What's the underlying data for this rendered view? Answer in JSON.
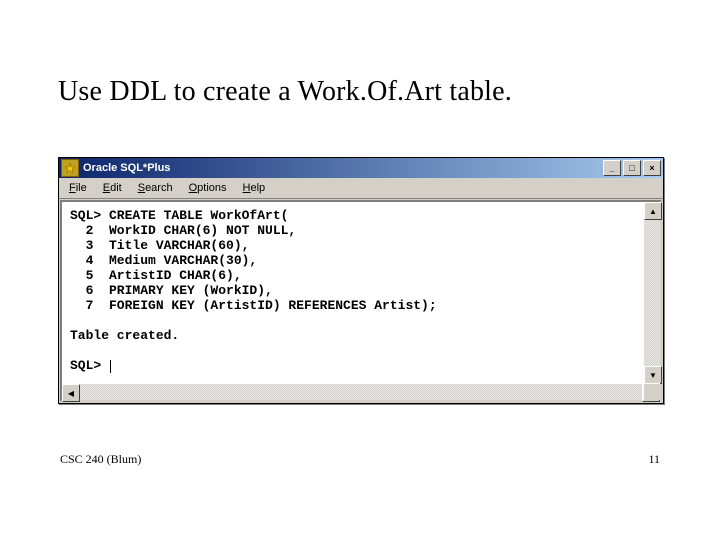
{
  "slide": {
    "title": "Use DDL to create a Work.Of.Art table.",
    "footer_left": "CSC 240 (Blum)",
    "footer_right": "11"
  },
  "window": {
    "title": "Oracle SQL*Plus",
    "menu": {
      "file": "File",
      "edit": "Edit",
      "search": "Search",
      "options": "Options",
      "help": "Help"
    },
    "buttons": {
      "minimize": "_",
      "maximize": "□",
      "close": "×"
    }
  },
  "terminal": {
    "prompt": "SQL>",
    "lines": [
      "SQL> CREATE TABLE WorkOfArt(",
      "  2  WorkID CHAR(6) NOT NULL,",
      "  3  Title VARCHAR(60),",
      "  4  Medium VARCHAR(30),",
      "  5  ArtistID CHAR(6),",
      "  6  PRIMARY KEY (WorkID),",
      "  7  FOREIGN KEY (ArtistID) REFERENCES Artist);",
      "",
      "Table created.",
      "",
      "SQL> "
    ]
  },
  "scroll": {
    "up": "▲",
    "down": "▼",
    "left": "◀",
    "right": "▶"
  }
}
